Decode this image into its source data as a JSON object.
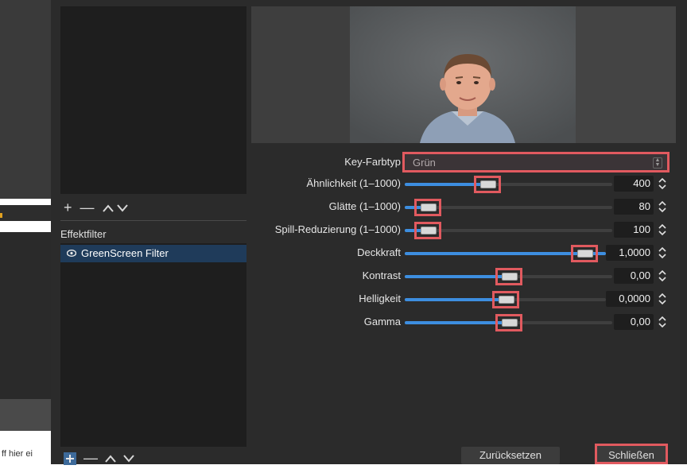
{
  "background_window": {
    "truncated_text": "ff hier ei"
  },
  "sources_toolbar": {
    "add": "+",
    "remove": "—",
    "up": "^",
    "down": "v"
  },
  "effects_panel": {
    "title": "Effektfilter",
    "items": [
      {
        "label": "GreenScreen Filter",
        "icon": "eye-icon"
      }
    ]
  },
  "effects_toolbar": {
    "add": "+",
    "remove": "—",
    "up": "^",
    "down": "v"
  },
  "settings": {
    "key_color_type": {
      "label": "Key-Farbtyp",
      "value": "Grün"
    },
    "rows": [
      {
        "label": "Ähnlichkeit (1–1000)",
        "value": "400",
        "fill": 0.4
      },
      {
        "label": "Glätte (1–1000)",
        "value": "80",
        "fill": 0.08
      },
      {
        "label": "Spill-Reduzierung (1–1000)",
        "value": "100",
        "fill": 0.1
      },
      {
        "label": "Deckkraft",
        "value": "1,0000",
        "fill": 1.0
      },
      {
        "label": "Kontrast",
        "value": "0,00",
        "fill": 0.5
      },
      {
        "label": "Helligkeit",
        "value": "0,0000",
        "fill": 0.5
      },
      {
        "label": "Gamma",
        "value": "0,00",
        "fill": 0.5
      }
    ]
  },
  "buttons": {
    "reset": "Zurücksetzen",
    "close": "Schließen"
  },
  "colors": {
    "accent": "#3d8ee0",
    "highlight": "#e15a5f",
    "selection": "#1f3b5a"
  }
}
